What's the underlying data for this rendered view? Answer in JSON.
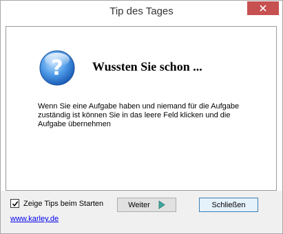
{
  "window": {
    "title": "Tip des Tages"
  },
  "tip": {
    "heading": "Wussten Sie schon ...",
    "text": "Wenn Sie eine Aufgabe haben und niemand für die Aufgabe zuständig ist können Sie in das leere Feld klicken und die Aufgabe übernehmen",
    "icon": "question-icon"
  },
  "footer": {
    "checkbox_label": "Zeige Tips beim Starten",
    "checkbox_checked": true,
    "next_label": "Weiter",
    "close_label": "Schließen",
    "link": "www.karley.de"
  },
  "colors": {
    "close_button": "#c75050",
    "link": "#0000ee",
    "arrow": "#3aa9a0"
  }
}
